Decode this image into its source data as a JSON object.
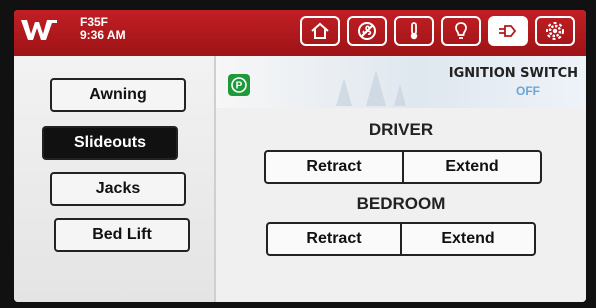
{
  "header": {
    "unit_line1": "F35F",
    "time": "9:36 AM",
    "colors": {
      "bar": "#b41a1e",
      "icon": "#ffffff",
      "active_icon": "#b41a1e"
    },
    "nav_icons": [
      "home-icon",
      "fan-off-icon",
      "thermometer-icon",
      "light-bulb-icon",
      "plug-icon",
      "gear-icon"
    ],
    "active_nav_icon": "plug-icon"
  },
  "sidebar": {
    "items": [
      {
        "label": "Awning"
      },
      {
        "label": "Slideouts"
      },
      {
        "label": "Jacks"
      },
      {
        "label": "Bed Lift"
      }
    ],
    "selected": "Slideouts"
  },
  "main": {
    "ignition": {
      "label": "IGNITION SWITCH",
      "status": "OFF"
    },
    "parking_icon": "parking-brake-icon",
    "groups": [
      {
        "title": "DRIVER",
        "buttons": [
          "Retract",
          "Extend"
        ]
      },
      {
        "title": "BEDROOM",
        "buttons": [
          "Retract",
          "Extend"
        ]
      }
    ]
  }
}
